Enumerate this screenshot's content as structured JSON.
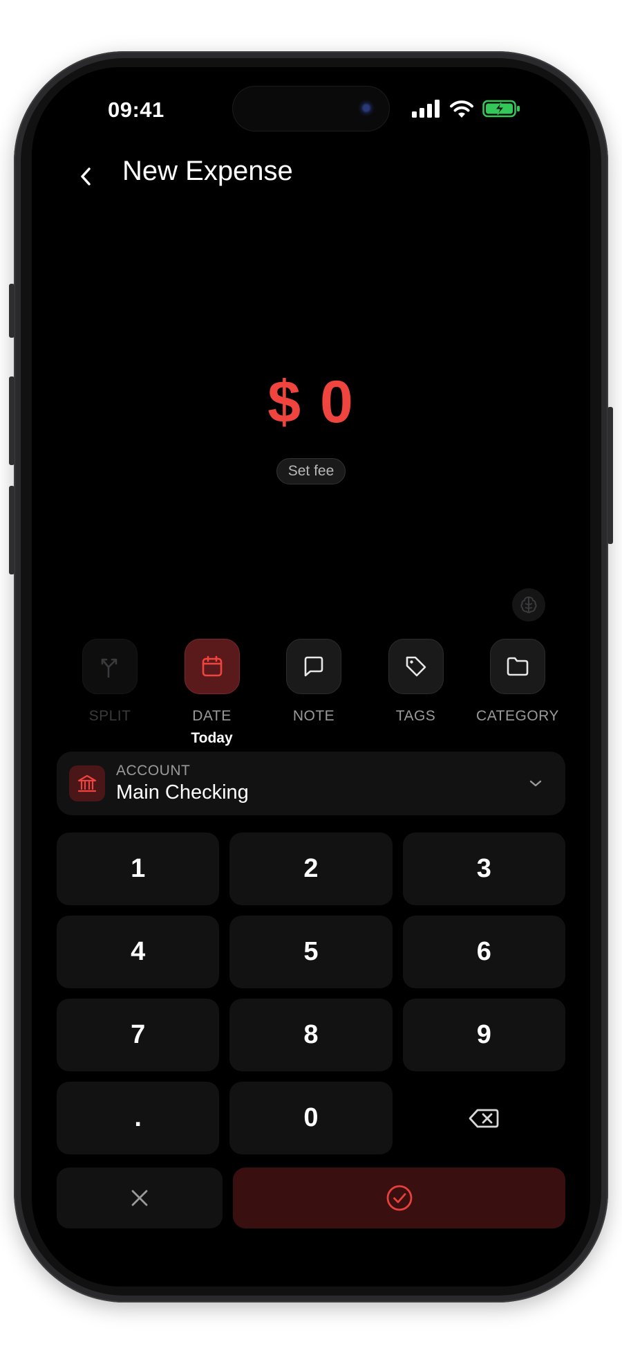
{
  "status_bar": {
    "time": "09:41",
    "icons": [
      "cellular-signal-icon",
      "wifi-icon",
      "battery-charging-icon"
    ],
    "battery_color": "#34c759"
  },
  "header": {
    "back_icon": "chevron-left-icon",
    "title": "New Expense"
  },
  "amount": {
    "display": "$ 0",
    "color": "#f0443f",
    "fee_label": "Set fee"
  },
  "ai_button": {
    "icon": "brain-icon"
  },
  "actions": [
    {
      "label": "SPLIT",
      "icon": "split-arrows-icon",
      "state": "disabled"
    },
    {
      "label": "DATE",
      "icon": "calendar-icon",
      "state": "active",
      "sub": "Today"
    },
    {
      "label": "NOTE",
      "icon": "message-square-icon",
      "state": "normal"
    },
    {
      "label": "TAGS",
      "icon": "tag-icon",
      "state": "normal"
    },
    {
      "label": "CATEGORY",
      "icon": "folder-icon",
      "state": "normal"
    }
  ],
  "account": {
    "caption": "ACCOUNT",
    "value": "Main Checking",
    "icon": "bank-icon",
    "chevron": "chevron-down-icon"
  },
  "keypad": {
    "keys": [
      "1",
      "2",
      "3",
      "4",
      "5",
      "6",
      "7",
      "8",
      "9",
      ".",
      "0"
    ],
    "backspace_icon": "backspace-icon"
  },
  "footer": {
    "cancel_icon": "close-icon",
    "confirm_icon": "check-circle-icon",
    "accent": "#e8413c"
  }
}
